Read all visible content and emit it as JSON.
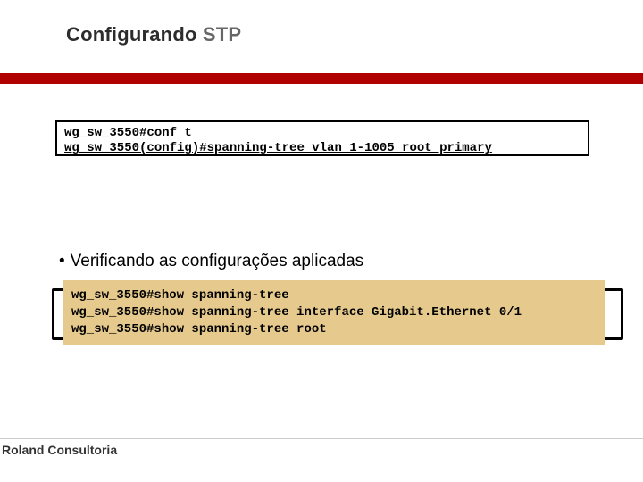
{
  "title": {
    "prefix": "Configurando ",
    "accent": "STP"
  },
  "config_box": {
    "line1": "wg_sw_3550#conf t",
    "line2": "wg_sw_3550(config)#spanning-tree vlan 1-1005 root primary"
  },
  "bullet": {
    "dot": "•",
    "text": "Verificando as configurações aplicadas"
  },
  "show_box": {
    "line1": "wg_sw_3550#show spanning-tree",
    "line2": "wg_sw_3550#show spanning-tree interface Gigabit.Ethernet 0/1",
    "line3": "wg_sw_3550#show spanning-tree root"
  },
  "footer": "Roland Consultoria"
}
